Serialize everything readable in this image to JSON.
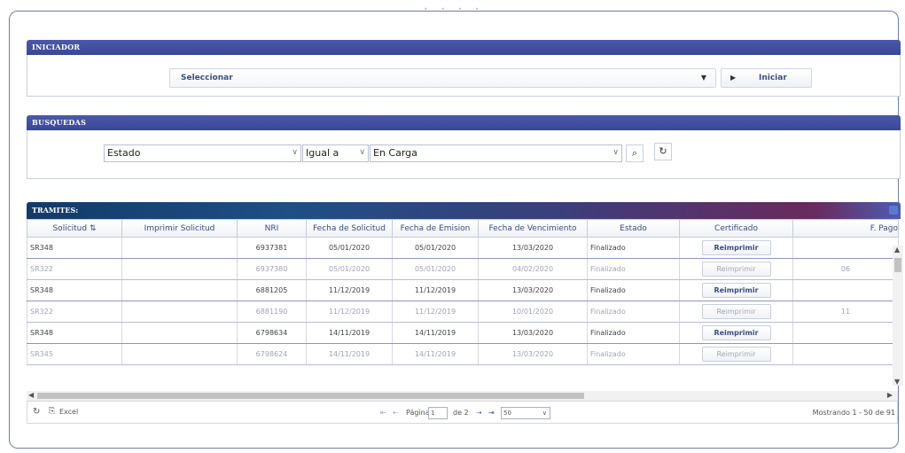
{
  "iniciador": {
    "title": "INICIADOR",
    "select_value": "Seleccionar",
    "start_button": "Iniciar"
  },
  "busquedas": {
    "title": "BUSQUEDAS",
    "field": "Estado",
    "operator": "Igual a",
    "value": "En Carga"
  },
  "tramites": {
    "title": "TRAMITES:",
    "columns": [
      "Solicitud",
      "Imprimir Solicitud",
      "NRI",
      "Fecha de Solicitud",
      "Fecha de Emision",
      "Fecha de Vencimiento",
      "Estado",
      "Certificado",
      "F. Pago"
    ],
    "rows": [
      {
        "solicitud": "SR348",
        "nri": "6937381",
        "fecha_solicitud": "05/01/2020",
        "fecha_emision": "05/01/2020",
        "fecha_vencimiento": "13/03/2020",
        "estado": "Finalizado",
        "certificado": "Reimprimir",
        "f_pago": ""
      },
      {
        "solicitud": "SR322",
        "nri": "6937380",
        "fecha_solicitud": "05/01/2020",
        "fecha_emision": "05/01/2020",
        "fecha_vencimiento": "04/02/2020",
        "estado": "Finalizado",
        "certificado": "Reimprimir",
        "f_pago": "06"
      },
      {
        "solicitud": "SR348",
        "nri": "6881205",
        "fecha_solicitud": "11/12/2019",
        "fecha_emision": "11/12/2019",
        "fecha_vencimiento": "13/03/2020",
        "estado": "Finalizado",
        "certificado": "Reimprimir",
        "f_pago": ""
      },
      {
        "solicitud": "SR322",
        "nri": "6881190",
        "fecha_solicitud": "11/12/2019",
        "fecha_emision": "11/12/2019",
        "fecha_vencimiento": "10/01/2020",
        "estado": "Finalizado",
        "certificado": "Reimprimir",
        "f_pago": "11"
      },
      {
        "solicitud": "SR348",
        "nri": "6798634",
        "fecha_solicitud": "14/11/2019",
        "fecha_emision": "14/11/2019",
        "fecha_vencimiento": "13/03/2020",
        "estado": "Finalizado",
        "certificado": "Reimprimir",
        "f_pago": ""
      },
      {
        "solicitud": "SR345",
        "nri": "6798624",
        "fecha_solicitud": "14/11/2019",
        "fecha_emision": "14/11/2019",
        "fecha_vencimiento": "13/03/2020",
        "estado": "Finalizado",
        "certificado": "Reimprimir",
        "f_pago": ""
      }
    ]
  },
  "footer": {
    "excel_label": "Excel",
    "page_label": "Página",
    "page_value": "1",
    "page_of": "de 2",
    "page_size": "50",
    "showing": "Mostrando 1 - 50 de 91"
  }
}
